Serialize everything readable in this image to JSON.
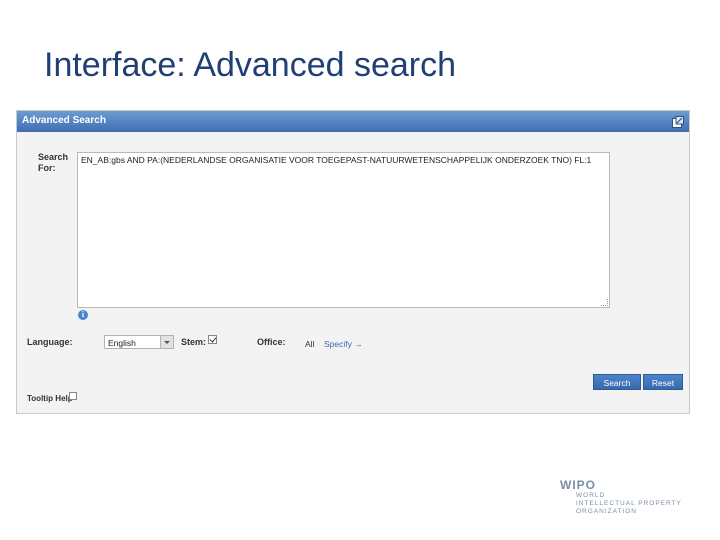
{
  "slide": {
    "title": "Interface: Advanced search"
  },
  "panel": {
    "title": "Advanced Search",
    "search_label": "Search For:",
    "query": "EN_AB:gbs AND PA:(NEDERLANDSE ORGANISATIE VOOR TOEGEPAST-NATUURWETENSCHAPPELIJK ONDERZOEK TNO) FL:1",
    "language_label": "Language:",
    "language_value": "English",
    "stem_label": "Stem:",
    "stem_checked": true,
    "office_label": "Office:",
    "office_value": "All",
    "specify_link": "Specify →",
    "search_button": "Search",
    "reset_button": "Reset",
    "tooltip_label": "Tooltip Help",
    "tooltip_checked": false
  },
  "logo": {
    "word": "WIPO",
    "line1": "WORLD",
    "line2": "INTELLECTUAL PROPERTY",
    "line3": "ORGANIZATION"
  },
  "colors": {
    "accent": "#3e6fb1",
    "title": "#1f3f75",
    "link": "#3767b0"
  },
  "icons": {
    "popout": "popout-icon",
    "info": "info-icon",
    "dropdown": "chevron-down-icon",
    "check": "checkmark-icon"
  }
}
